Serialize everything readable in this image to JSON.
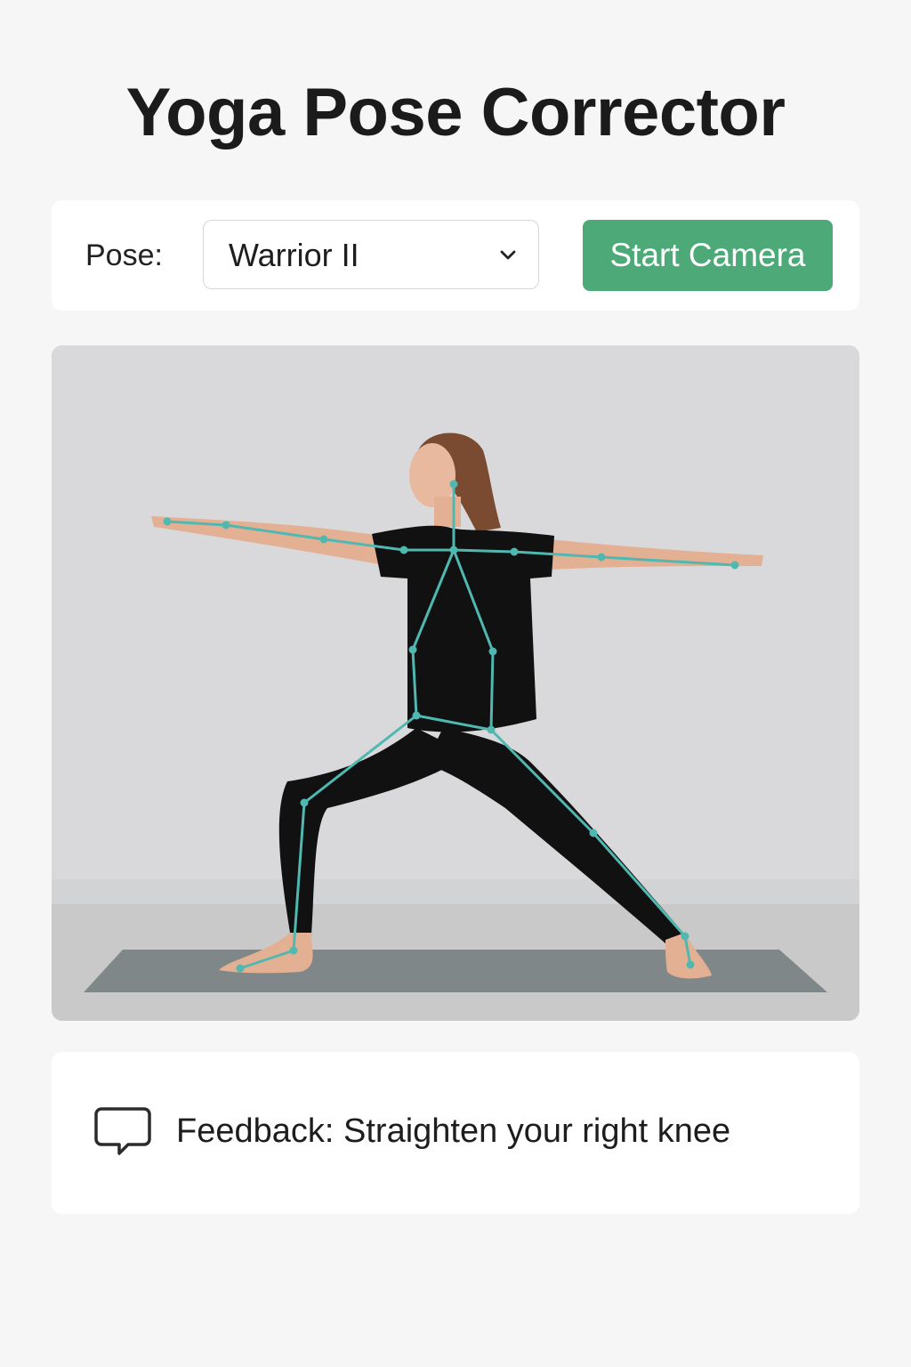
{
  "header": {
    "title": "Yoga Pose Corrector"
  },
  "controls": {
    "pose_label": "Pose:",
    "pose_selected": "Warrior II",
    "start_button_label": "Start Camera"
  },
  "camera": {
    "skeleton_color": "#4fb8b0"
  },
  "feedback": {
    "label": "Feedback:",
    "message": "Straighten your right knee",
    "icon": "speech-bubble-icon"
  },
  "colors": {
    "accent_button": "#4daa78",
    "background": "#f6f6f6",
    "card": "#ffffff"
  }
}
